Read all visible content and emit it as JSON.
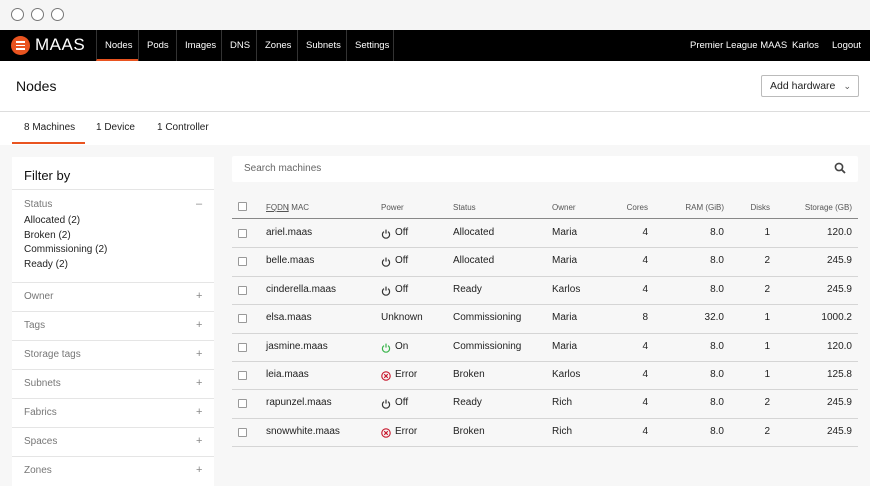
{
  "nav": {
    "brand": "MAAS",
    "items": [
      "Nodes",
      "Pods",
      "Images",
      "DNS",
      "Zones",
      "Subnets",
      "Settings"
    ],
    "org": "Premier League MAAS",
    "user": "Karlos",
    "logout": "Logout"
  },
  "header": {
    "title": "Nodes",
    "add_hardware": "Add hardware",
    "chevron": "⌄",
    "tabs": [
      "8 Machines",
      "1 Device",
      "1 Controller"
    ]
  },
  "filter": {
    "title": "Filter by",
    "status_label": "Status",
    "status_options": [
      "Allocated (2)",
      "Broken (2)",
      "Commissioning (2)",
      "Ready (2)"
    ],
    "collapse_symbol": "–",
    "expand_symbol": "+",
    "groups": [
      "Owner",
      "Tags",
      "Storage tags",
      "Subnets",
      "Fabrics",
      "Spaces",
      "Zones"
    ]
  },
  "search": {
    "placeholder": "Search machines"
  },
  "table": {
    "headers": {
      "fqdn": "FQDN",
      "mac": "| MAC",
      "power": "Power",
      "status": "Status",
      "owner": "Owner",
      "cores": "Cores",
      "ram": "RAM (GiB)",
      "disks": "Disks",
      "storage": "Storage (GB)"
    },
    "rows": [
      {
        "fqdn": "ariel.maas",
        "power": "Off",
        "power_icon": "power-icon",
        "status": "Allocated",
        "owner": "Maria",
        "cores": "4",
        "ram": "8.0",
        "disks": "1",
        "storage": "120.0"
      },
      {
        "fqdn": "belle.maas",
        "power": "Off",
        "power_icon": "power-icon",
        "status": "Allocated",
        "owner": "Maria",
        "cores": "4",
        "ram": "8.0",
        "disks": "2",
        "storage": "245.9"
      },
      {
        "fqdn": "cinderella.maas",
        "power": "Off",
        "power_icon": "power-icon",
        "status": "Ready",
        "owner": "Karlos",
        "cores": "4",
        "ram": "8.0",
        "disks": "2",
        "storage": "245.9"
      },
      {
        "fqdn": "elsa.maas",
        "power": "Unknown",
        "power_icon": "",
        "status": "Commissioning",
        "owner": "Maria",
        "cores": "8",
        "ram": "32.0",
        "disks": "1",
        "storage": "1000.2"
      },
      {
        "fqdn": "jasmine.maas",
        "power": "On",
        "power_icon": "power-on-icon",
        "status": "Commissioning",
        "owner": "Maria",
        "cores": "4",
        "ram": "8.0",
        "disks": "1",
        "storage": "120.0"
      },
      {
        "fqdn": "leia.maas",
        "power": "Error",
        "power_icon": "error-icon",
        "status": "Broken",
        "owner": "Karlos",
        "cores": "4",
        "ram": "8.0",
        "disks": "1",
        "storage": "125.8"
      },
      {
        "fqdn": "rapunzel.maas",
        "power": "Off",
        "power_icon": "power-icon",
        "status": "Ready",
        "owner": "Rich",
        "cores": "4",
        "ram": "8.0",
        "disks": "2",
        "storage": "245.9"
      },
      {
        "fqdn": "snowwhite.maas",
        "power": "Error",
        "power_icon": "error-icon",
        "status": "Broken",
        "owner": "Rich",
        "cores": "4",
        "ram": "8.0",
        "disks": "2",
        "storage": "245.9"
      }
    ]
  },
  "colors": {
    "accent": "#e95420",
    "power_on": "#38b44a",
    "error": "#c7162b",
    "nav_bg": "#000000"
  }
}
